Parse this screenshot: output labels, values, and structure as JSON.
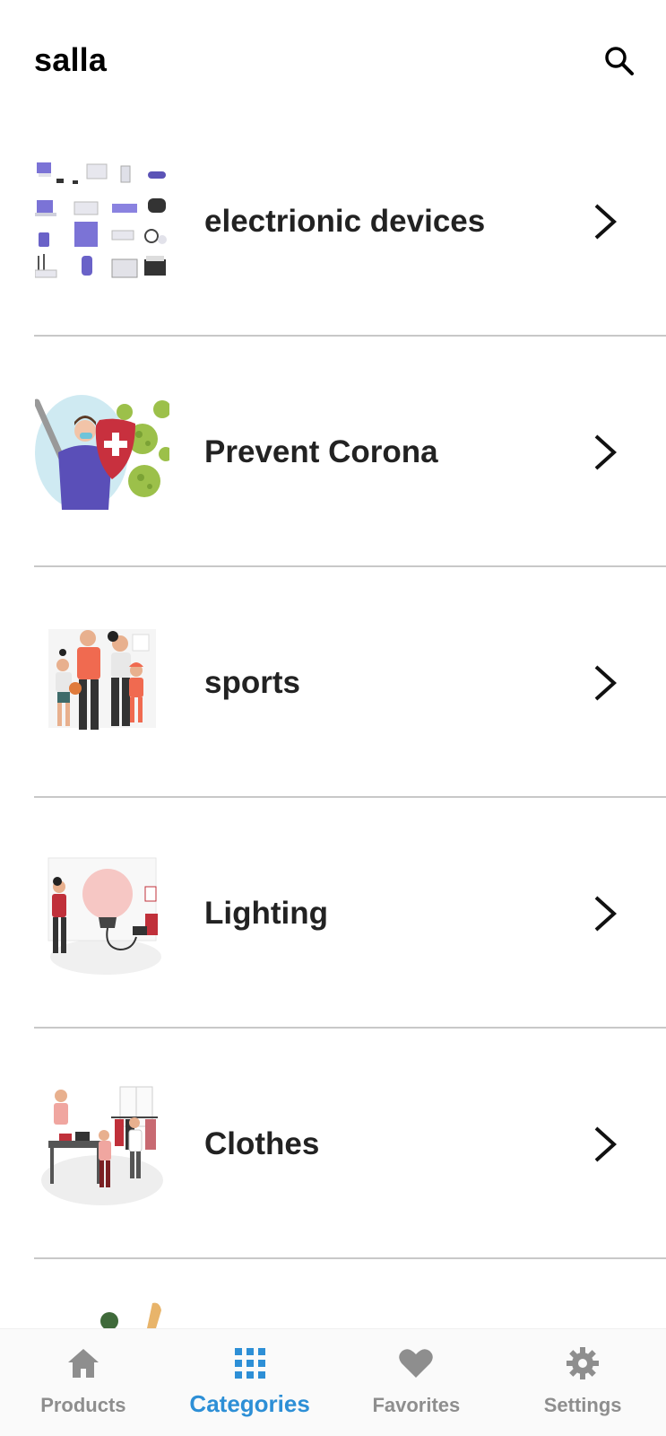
{
  "app": {
    "title": "salla"
  },
  "categories": [
    {
      "label": "electrionic devices",
      "image": "electronic-devices-illustration"
    },
    {
      "label": "Prevent Corona",
      "image": "prevent-corona-illustration"
    },
    {
      "label": "sports",
      "image": "sports-family-illustration"
    },
    {
      "label": "Lighting",
      "image": "lighting-bulb-illustration"
    },
    {
      "label": "Clothes",
      "image": "clothes-shop-illustration"
    }
  ],
  "bottom_nav": {
    "items": [
      {
        "label": "Products",
        "icon": "home-icon",
        "active": false
      },
      {
        "label": "Categories",
        "icon": "grid-icon",
        "active": true
      },
      {
        "label": "Favorites",
        "icon": "heart-icon",
        "active": false
      },
      {
        "label": "Settings",
        "icon": "gear-icon",
        "active": false
      }
    ]
  },
  "colors": {
    "active": "#2d8fd6",
    "inactive": "#8e8e8e",
    "divider": "#c8c8c8",
    "text": "#222222"
  }
}
